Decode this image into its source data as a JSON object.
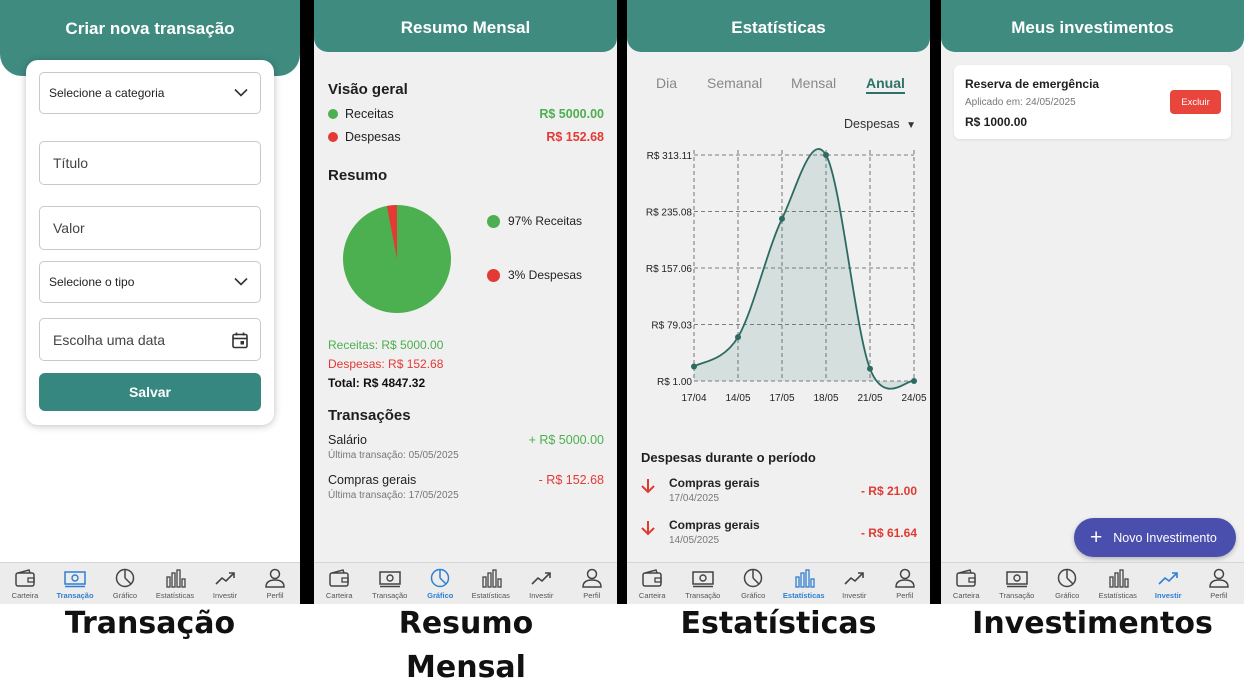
{
  "screens": {
    "transacao": {
      "title": "Criar nova transação",
      "category_select": "Selecione a categoria",
      "title_placeholder": "Título",
      "value_placeholder": "Valor",
      "type_select": "Selecione o tipo",
      "date_placeholder": "Escolha uma data",
      "save_label": "Salvar",
      "active_tab": "transacao"
    },
    "resumo": {
      "title": "Resumo Mensal",
      "overview_heading": "Visão geral",
      "receitas_label": "Receitas",
      "receitas_value": "R$ 5000.00",
      "despesas_label": "Despesas",
      "despesas_value": "R$ 152.68",
      "summary_heading": "Resumo",
      "pie_receitas": "97% Receitas",
      "pie_despesas": "3% Despesas",
      "pie_receitas_fraction": 0.97,
      "pie_despesas_fraction": 0.03,
      "receitas_line": "Receitas: R$ 5000.00",
      "despesas_line": "Despesas: R$ 152.68",
      "total_line": "Total: R$ 4847.32",
      "transactions_heading": "Transações",
      "transactions": [
        {
          "name": "Salário",
          "sub": "Última transação: 05/05/2025",
          "value": "+ R$ 5000.00",
          "color": "#4caf50"
        },
        {
          "name": "Compras gerais",
          "sub": "Última transação: 17/05/2025",
          "value": "- R$ 152.68",
          "color": "#e53935"
        }
      ],
      "active_tab": "grafico"
    },
    "estatisticas": {
      "title": "Estatísticas",
      "periods": [
        "Dia",
        "Semanal",
        "Mensal",
        "Anual"
      ],
      "active_period": "Anual",
      "filter": "Despesas",
      "expenses_heading": "Despesas durante o período",
      "expenses": [
        {
          "name": "Compras gerais",
          "date": "17/04/2025",
          "value": "- R$ 21.00"
        },
        {
          "name": "Compras gerais",
          "date": "14/05/2025",
          "value": "- R$ 61.64"
        }
      ],
      "active_tab": "estatisticas"
    },
    "investimentos": {
      "title": "Meus investimentos",
      "card_name": "Reserva de emergência",
      "card_date": "Aplicado em: 24/05/2025",
      "card_amount": "R$ 1000.00",
      "delete_label": "Excluir",
      "fab_label": "Novo Investimento",
      "active_tab": "investir"
    }
  },
  "nav": [
    "Carteira",
    "Transação",
    "Gráfico",
    "Estatísticas",
    "Investir",
    "Perfil"
  ],
  "nav_icons": [
    "wallet-icon",
    "cash-icon",
    "pie-chart-icon",
    "bar-chart-icon",
    "trending-up-icon",
    "person-icon"
  ],
  "captions": {
    "transacao": "Transação",
    "resumo": "Resumo Mensal",
    "estatisticas": "Estatísticas",
    "investimentos": "Investimentos"
  },
  "colors": {
    "primary": "#3f8b80",
    "income": "#4caf50",
    "expense": "#e53935",
    "active_nav": "#2f7fd0",
    "fab": "#4a4fae"
  },
  "chart_data": {
    "type": "line",
    "x": [
      "17/04",
      "14/05",
      "17/05",
      "18/05",
      "21/05",
      "24/05"
    ],
    "y_ticks": [
      "R$ 1.00",
      "R$ 79.03",
      "R$ 157.06",
      "R$ 235.08",
      "R$ 313.11"
    ],
    "ylim": [
      1.0,
      313.11
    ],
    "values": [
      21.0,
      61.64,
      225.0,
      313.11,
      18.0,
      1.0
    ],
    "grid": true,
    "fill": true
  }
}
